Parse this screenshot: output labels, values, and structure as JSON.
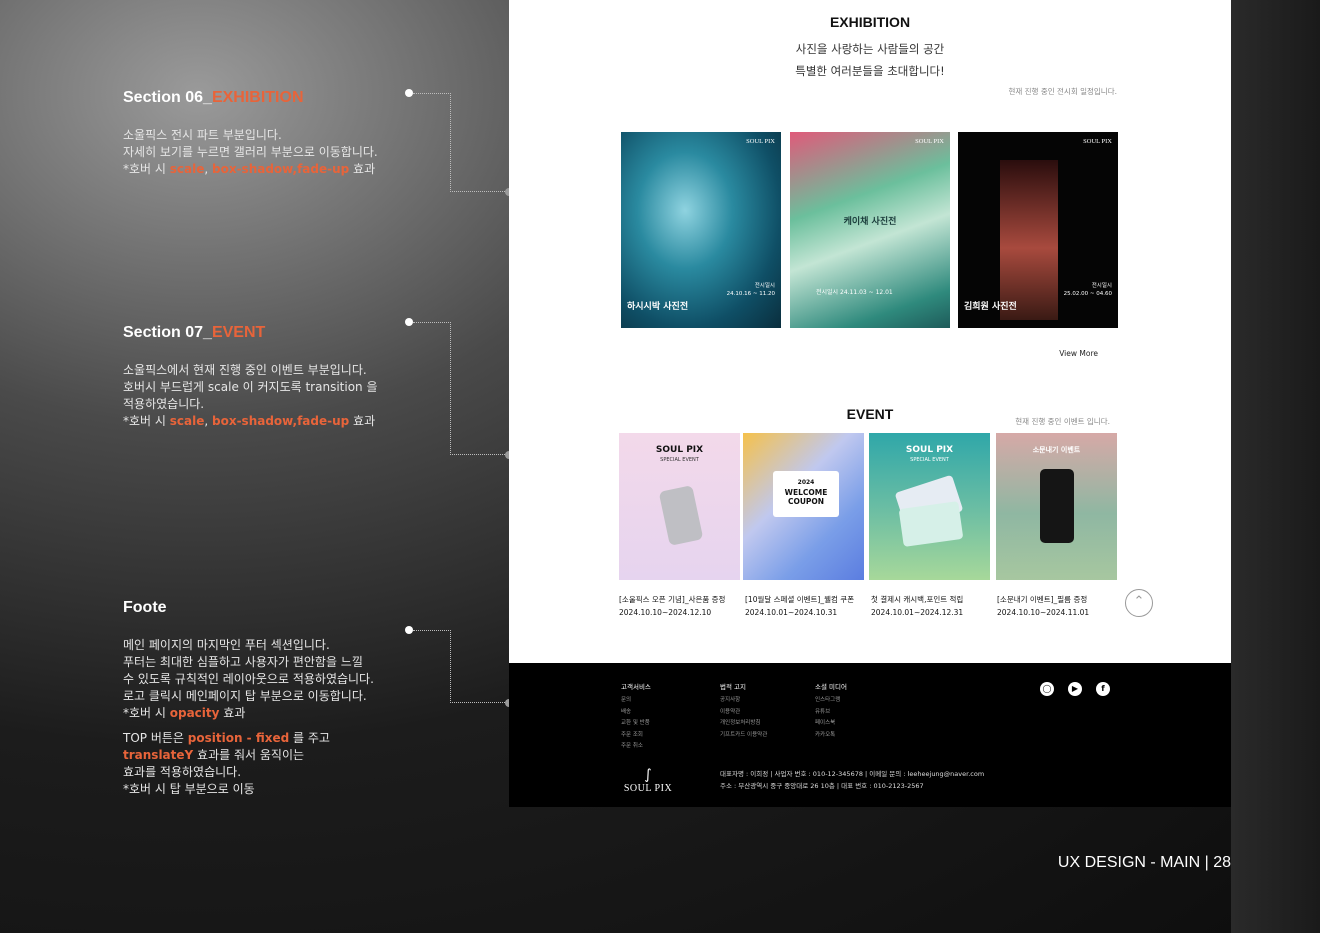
{
  "annotations": {
    "s06": {
      "title_prefix": "Section 06_",
      "title_accent": "EXHIBITION",
      "l1": "소울픽스 전시 파트 부분입니다.",
      "l2": "자세히 보기를 누르면 갤러리 부분으로 이동합니다.",
      "l3a": "*호버 시 ",
      "l3b": "scale",
      "l3c": ", ",
      "l3d": "box-shadow",
      "l3e": ",",
      "l3f": "fade-up",
      "l3g": " 효과"
    },
    "s07": {
      "title_prefix": "Section 07_",
      "title_accent": "EVENT",
      "l1": "소울픽스에서 현재 진행 중인 이벤트 부분입니다.",
      "l2": "호버시 부드럽게 scale 이 커지도록 transition 을",
      "l3": "적용하였습니다.",
      "l4a": "*호버 시 ",
      "l4b": "scale",
      "l4c": ", ",
      "l4d": "box-shadow",
      "l4e": ",",
      "l4f": "fade-up",
      "l4g": " 효과"
    },
    "foot": {
      "title": "Foote",
      "l1": "메인 페이지의 마지막인 푸터 섹션입니다.",
      "l2": "푸터는 최대한 심플하고 사용자가 편안함을 느낄",
      "l3": "수 있도록 규칙적인 레이아웃으로 적용하였습니다.",
      "l4": "로고 클릭시 메인페이지 탑 부분으로 이동합니다.",
      "l5a": "*호버 시  ",
      "l5b": "opacity",
      "l5c": " 효과",
      "l6a": "TOP 버튼은 ",
      "l6b": "position - fixed",
      "l6c": " 를 주고",
      "l7a": "translateY",
      "l7b": " 효과를 줘서 움직이는",
      "l8": "효과를 적용하였습니다.",
      "l9": "*호버 시 탑 부분으로 이동"
    }
  },
  "exhibition": {
    "title": "EXHIBITION",
    "sub1": "사진을 사랑하는 사람들의 공간",
    "sub2": "특별한 여러분들을 초대합니다!",
    "note": "현재 진행 중인 전시회 일정입니다.",
    "brand": "SOUL PIX",
    "posters": [
      {
        "title": "하시시박 사진전",
        "info1": "전시일시",
        "info2": "24.10.16 ~ 11.20"
      },
      {
        "title": "",
        "info1": "전시일시",
        "info2": "24.11.03 ~ 12.01",
        "center_title": "케이채 사진전"
      },
      {
        "title": "김희원 사진전",
        "info1": "전시일시",
        "info2": "25.02.00 ~ 04.60"
      }
    ],
    "view_more": "View More"
  },
  "event": {
    "title": "EVENT",
    "note": "현재 진행 중인 이벤트 입니다.",
    "cards": [
      {
        "name": "[소울픽스 오픈 기념]_사은품 증정",
        "date": "2024.10.10~2024.12.10",
        "art": "SOUL PIX",
        "art2": "SPECIAL EVENT"
      },
      {
        "name": "[10월달 스페셜 이벤트]_웰컴 쿠폰",
        "date": "2024.10.01~2024.10.31",
        "art": "2024",
        "art2": "WELCOME COUPON"
      },
      {
        "name": "첫 결제시 캐시백,포인트 적립",
        "date": "2024.10.01~2024.12.31",
        "art": "SOUL PIX",
        "art2": "SPECIAL EVENT"
      },
      {
        "name": "[소문내기 이벤트]_필름 증정",
        "date": "2024.10.10~2024.11.01",
        "art": "소문내기 이벤트",
        "art2": ""
      }
    ],
    "top_icon": "chevron-up"
  },
  "footer": {
    "col1": {
      "head": "고객서비스",
      "items": [
        "문의",
        "배송",
        "교환 및 반품",
        "주문 조회",
        "주문 취소"
      ]
    },
    "col2": {
      "head": "법적 고지",
      "items": [
        "공지사항",
        "이용약관",
        "개인정보처리방침",
        "기프트카드 이용약관"
      ]
    },
    "col3": {
      "head": "소셜 미디어",
      "items": [
        "인스타그램",
        "유튜브",
        "페이스북",
        "카카오톡"
      ]
    },
    "social": [
      "instagram-icon",
      "youtube-icon",
      "facebook-icon"
    ],
    "logo": "SOUL PIX",
    "addr1": "대표자명 : 이희정  |  사업자 번호 : 010-12-345678  |  이메일 문의 : leeheejung@naver.com",
    "addr2": "주소 : 부산광역시 중구 중앙대로 26 10층  |  대표 번호 : 010-2123-2567"
  },
  "page_label": "UX DESIGN - MAIN | 28"
}
